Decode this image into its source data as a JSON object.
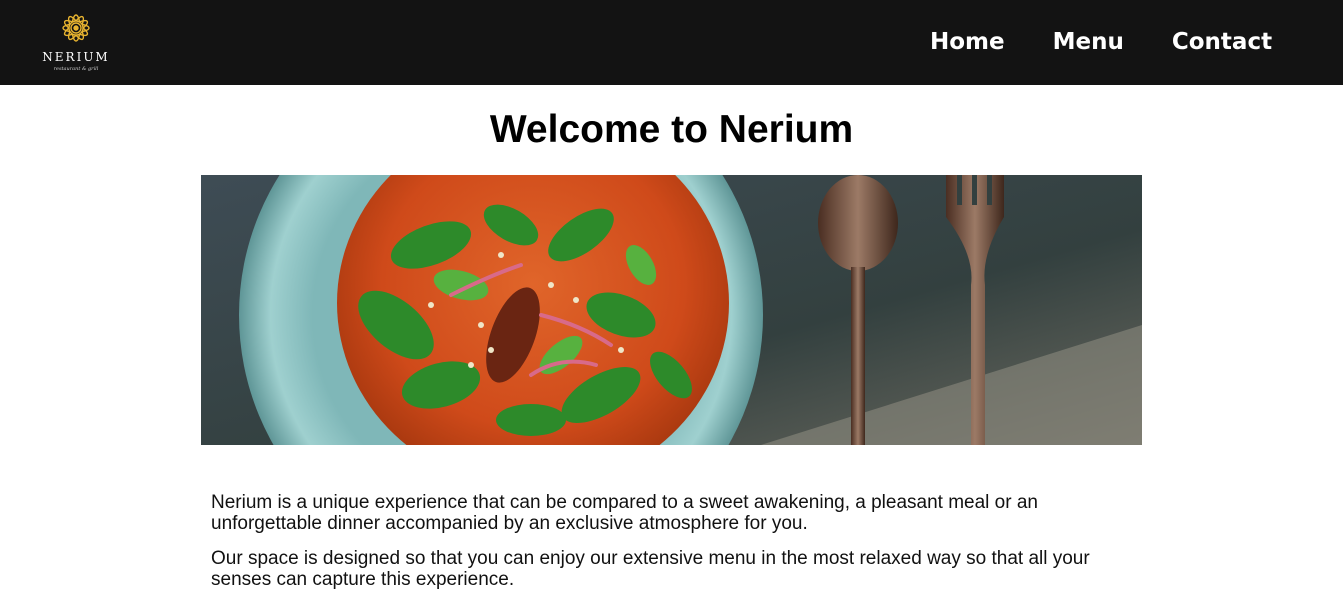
{
  "brand": {
    "name": "NERIUM",
    "tagline": "restaurant & grill",
    "icon": "sunflower-logo-icon",
    "accent_color": "#E8B430"
  },
  "nav": {
    "items": [
      {
        "label": "Home"
      },
      {
        "label": "Menu"
      },
      {
        "label": "Contact"
      }
    ]
  },
  "main": {
    "title": "Welcome to Nerium",
    "hero_image": "soup-bowl-with-spoon-and-fork-photo",
    "paragraphs": [
      "Nerium is a unique experience that can be compared to a sweet awakening, a pleasant meal or an unforgettable dinner accompanied by an exclusive atmosphere for you.",
      "Our space is designed so that you can enjoy our extensive menu in the most relaxed way so that all your senses can capture this experience."
    ]
  },
  "colors": {
    "navbar_bg": "#131313",
    "nav_text": "#FFFFFF",
    "body_text": "#111111"
  }
}
